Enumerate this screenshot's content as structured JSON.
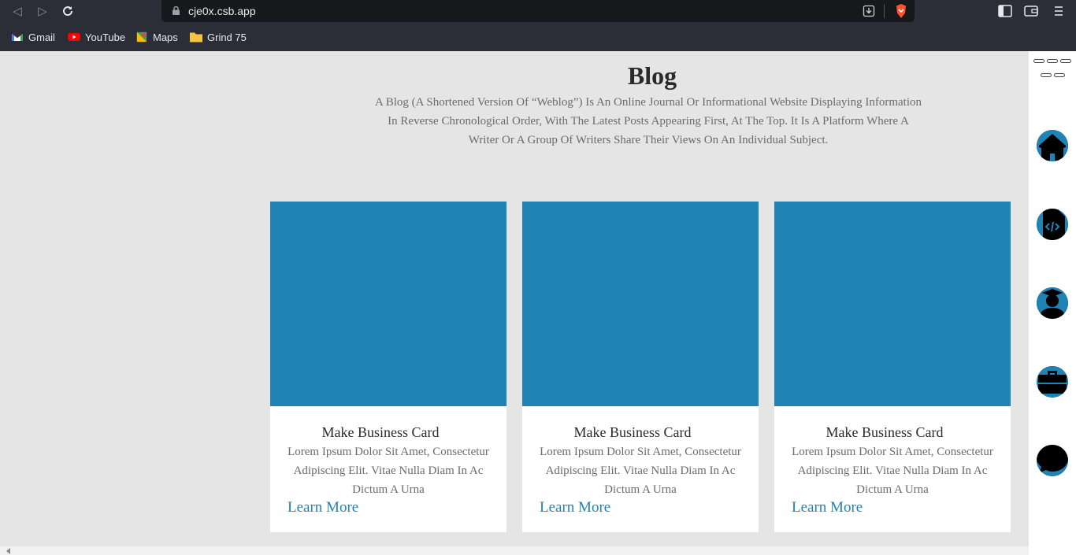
{
  "browser": {
    "url": "cje0x.csb.app",
    "icons": {
      "back": "back-arrow-icon",
      "forward": "forward-arrow-icon",
      "reload": "reload-icon",
      "lock": "lock-icon",
      "download": "download-icon",
      "brave": "brave-shield-icon",
      "sidebar": "sidebar-toggle-icon",
      "wallet": "wallet-icon",
      "menu": "menu-icon"
    },
    "bookmarks": [
      {
        "label": "Gmail",
        "icon": "gmail-icon"
      },
      {
        "label": "YouTube",
        "icon": "youtube-icon"
      },
      {
        "label": "Maps",
        "icon": "maps-icon"
      },
      {
        "label": "Grind 75",
        "icon": "folder-icon"
      }
    ]
  },
  "blog": {
    "title": "Blog",
    "description": "A Blog (A Shortened Version Of “Weblog”) Is An Online Journal Or Informational Website Displaying Information In Reverse Chronological Order, With The Latest Posts Appearing First, At The Top. It Is A Platform Where A Writer Or A Group Of Writers Share Their Views On An Individual Subject."
  },
  "cards": [
    {
      "title": "Make Business Card",
      "text": "Lorem Ipsum Dolor Sit Amet, Consectetur Adipiscing Elit. Vitae Nulla Diam In Ac Dictum A Urna",
      "link": "Learn More"
    },
    {
      "title": "Make Business Card",
      "text": "Lorem Ipsum Dolor Sit Amet, Consectetur Adipiscing Elit. Vitae Nulla Diam In Ac Dictum A Urna",
      "link": "Learn More"
    },
    {
      "title": "Make Business Card",
      "text": "Lorem Ipsum Dolor Sit Amet, Consectetur Adipiscing Elit. Vitae Nulla Diam In Ac Dictum A Urna",
      "link": "Learn More"
    }
  ],
  "sidebar_nav": [
    "home-icon",
    "code-file-icon",
    "user-graduate-icon",
    "briefcase-icon",
    "chat-bubble-icon"
  ],
  "colors": {
    "accent": "#1f84b5",
    "page_bg": "#e5e5e5",
    "card_bg": "#ffffff"
  }
}
